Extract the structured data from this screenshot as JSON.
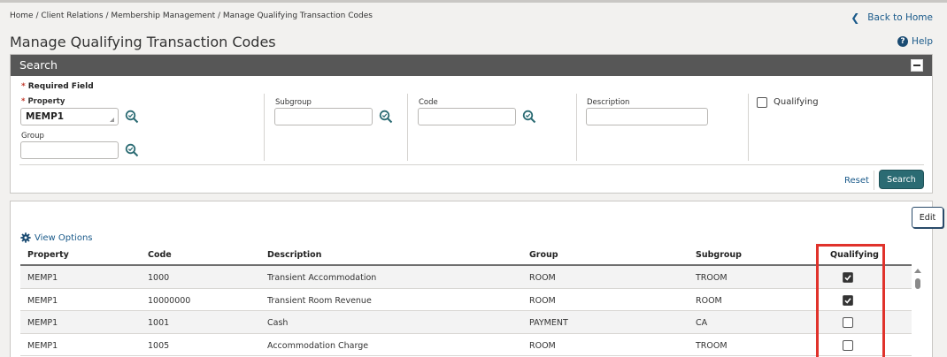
{
  "breadcrumb": "Home / Client Relations / Membership Management / Manage Qualifying Transaction Codes",
  "back_home": "Back to Home",
  "page_title": "Manage Qualifying Transaction Codes",
  "help": "Help",
  "search": {
    "title": "Search",
    "required_field": "Required Field",
    "property_label": "Property",
    "property_value": "MEMP1",
    "group_label": "Group",
    "subgroup_label": "Subgroup",
    "code_label": "Code",
    "description_label": "Description",
    "qualifying_label": "Qualifying",
    "reset": "Reset",
    "search_button": "Search"
  },
  "results": {
    "edit": "Edit",
    "view_options": "View Options",
    "columns": [
      "Property",
      "Code",
      "Description",
      "Group",
      "Subgroup",
      "Qualifying"
    ],
    "rows": [
      {
        "property": "MEMP1",
        "code": "1000",
        "description": "Transient Accommodation",
        "group": "ROOM",
        "subgroup": "TROOM",
        "qualifying": true
      },
      {
        "property": "MEMP1",
        "code": "10000000",
        "description": "Transient Room Revenue",
        "group": "ROOM",
        "subgroup": "ROOM",
        "qualifying": true
      },
      {
        "property": "MEMP1",
        "code": "1001",
        "description": "Cash",
        "group": "PAYMENT",
        "subgroup": "CA",
        "qualifying": false
      },
      {
        "property": "MEMP1",
        "code": "1005",
        "description": "Accommodation Charge",
        "group": "ROOM",
        "subgroup": "TROOM",
        "qualifying": false
      }
    ]
  },
  "colors": {
    "header_bar": "#575757",
    "link": "#1a5a8a",
    "primary_button": "#2b6b73",
    "highlight": "#e0322b",
    "required": "#c0392b"
  }
}
